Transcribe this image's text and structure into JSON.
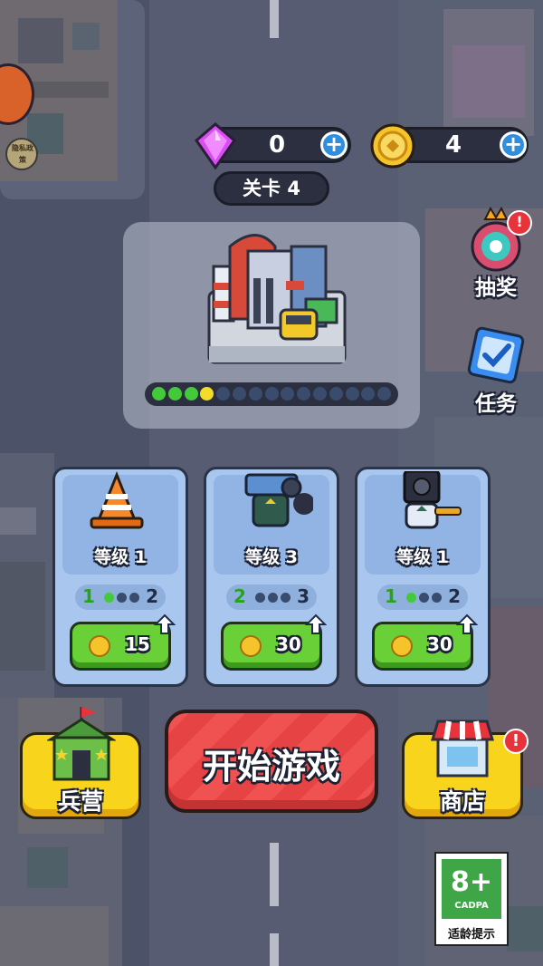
{
  "hud": {
    "gems": "0",
    "coins": "4",
    "level_label": "关卡 4"
  },
  "privacy_badge": "隐私政策",
  "side_menu": {
    "lottery_label": "抽奖",
    "tasks_label": "任务"
  },
  "stage_preview": {
    "progress_done": 4,
    "progress_total": 15
  },
  "upgrade_cards": [
    {
      "level": "等级 1",
      "from": "1",
      "to": "2",
      "dots_on": 1,
      "dots_total": 3,
      "cost": "15"
    },
    {
      "level": "等级 3",
      "from": "2",
      "to": "3",
      "dots_on": 0,
      "dots_total": 3,
      "cost": "30"
    },
    {
      "level": "等级 1",
      "from": "1",
      "to": "2",
      "dots_on": 1,
      "dots_total": 3,
      "cost": "30"
    }
  ],
  "bottom": {
    "barracks_label": "兵营",
    "start_label": "开始游戏",
    "shop_label": "商店"
  },
  "age_rating": {
    "rating": "8+",
    "org": "CADPA",
    "caption": "适龄提示"
  },
  "colors": {
    "start_button": "#ef4a4a",
    "buy_button": "#6ad038",
    "side_button": "#f8d51c",
    "gem": "#d94ef0",
    "coin": "#f5c42a"
  }
}
